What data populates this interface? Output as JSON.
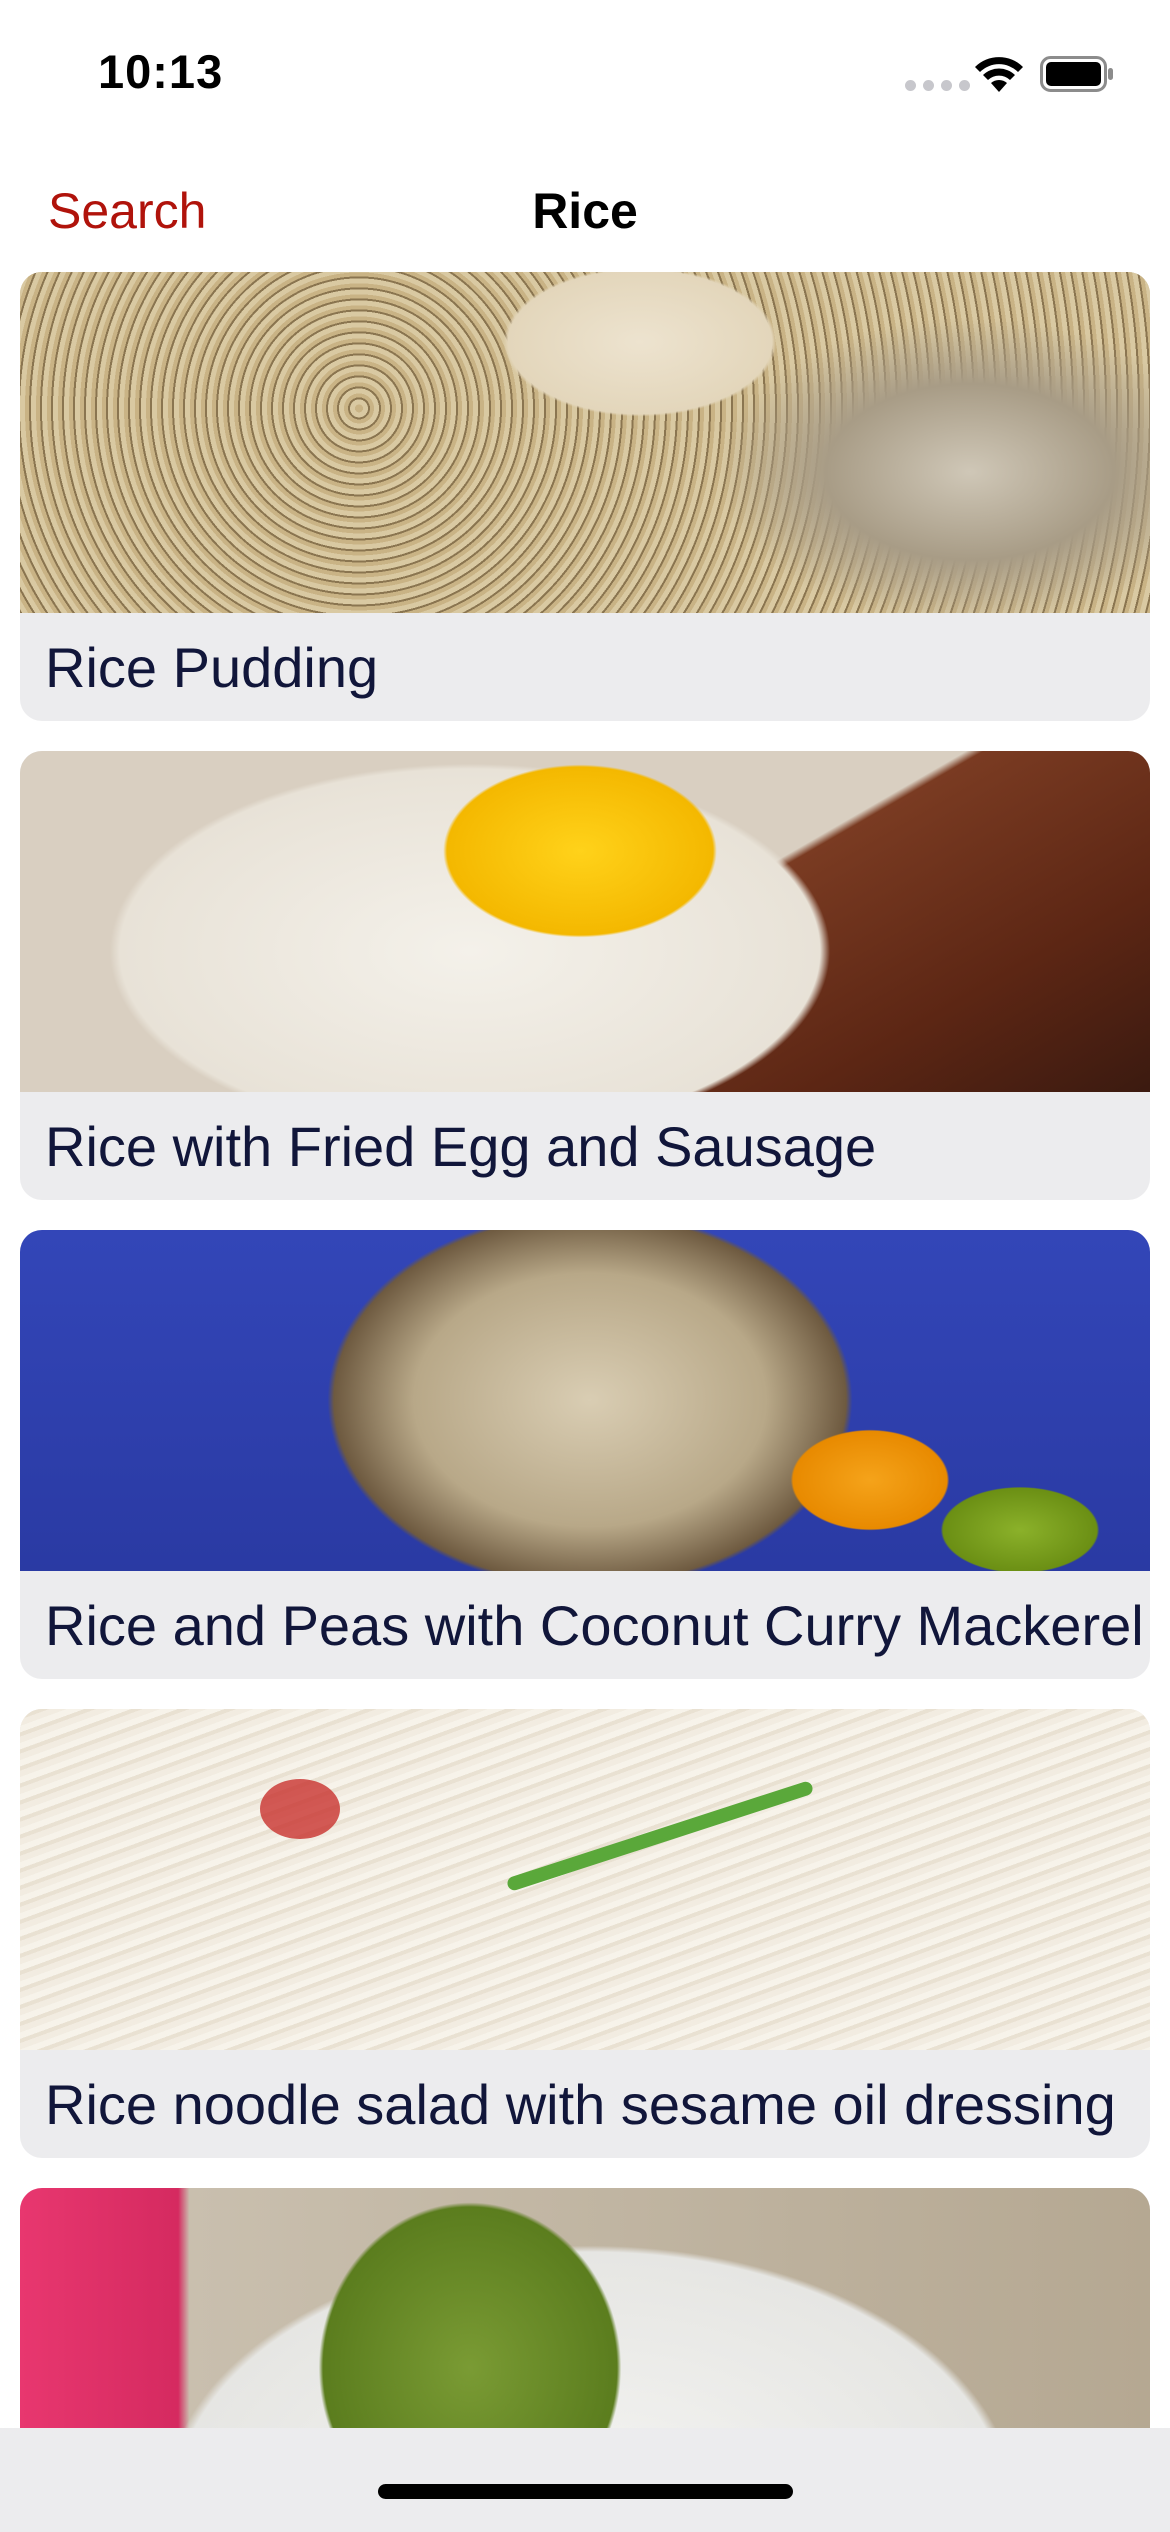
{
  "status_bar": {
    "time": "10:13",
    "icons": [
      "cellular-signal-icon",
      "wifi-icon",
      "battery-icon"
    ]
  },
  "nav": {
    "back_label": "Search",
    "title": "Rice",
    "accent_color": "#b0130b"
  },
  "recipes": [
    {
      "name": "Rice Pudding",
      "image": "rice-pudding-photo"
    },
    {
      "name": "Rice with Fried Egg and Sausage",
      "image": "rice-fried-egg-sausage-photo"
    },
    {
      "name": "Rice and Peas with Coconut Curry Mackerel",
      "image": "rice-peas-coconut-curry-mackerel-photo"
    },
    {
      "name": "Rice noodle salad with sesame oil dressing",
      "image": "rice-noodle-salad-photo"
    },
    {
      "name": "",
      "image": "stuffed-pepper-photo"
    }
  ],
  "colors": {
    "card_background": "#ececee",
    "label_text": "#11163a"
  }
}
